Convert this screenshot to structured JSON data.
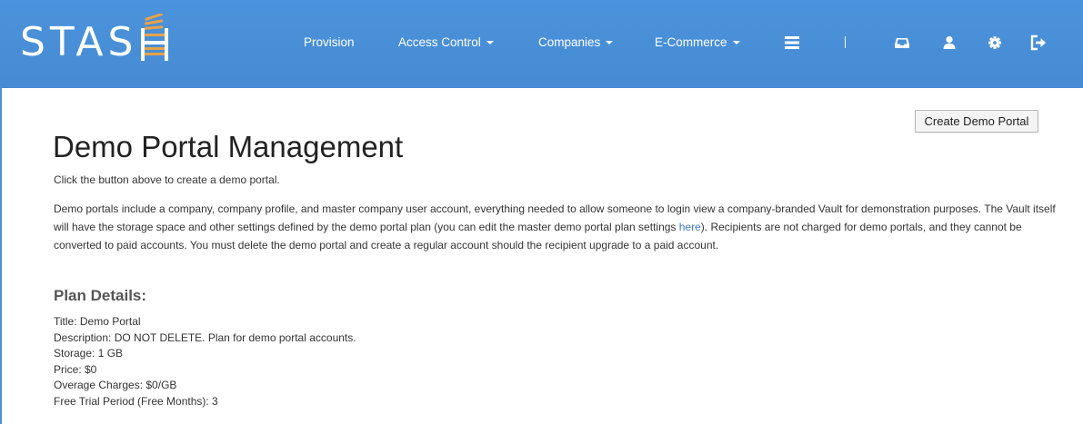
{
  "brand": {
    "text": "STAS"
  },
  "nav": {
    "items": [
      {
        "label": "Provision",
        "dropdown": false
      },
      {
        "label": "Access Control",
        "dropdown": true
      },
      {
        "label": "Companies",
        "dropdown": true
      },
      {
        "label": "E-Commerce",
        "dropdown": true
      }
    ],
    "icons": [
      "menu-icon",
      "inbox-icon",
      "user-icon",
      "gear-icon",
      "logout-icon"
    ]
  },
  "colors": {
    "navbar": "#4a90d9",
    "link": "#3b7bbf"
  },
  "actions": {
    "create_label": "Create Demo Portal"
  },
  "page": {
    "title": "Demo Portal Management",
    "intro": "Click the button above to create a demo portal.",
    "description_before_link": "Demo portals include a company, company profile, and master company user account, everything needed to allow someone to login view a company-branded Vault for demonstration purposes. The Vault itself will have the storage space and other settings defined by the demo portal plan (you can edit the master demo portal plan settings ",
    "description_link": "here",
    "description_after_link": "). Recipients are not charged for demo portals, and they cannot be converted to paid accounts. You must delete the demo portal and create a regular account should the recipient upgrade to a paid account."
  },
  "plan": {
    "heading": "Plan Details:",
    "rows": [
      "Title: Demo Portal",
      "Description: DO NOT DELETE. Plan for demo portal accounts.",
      "Storage: 1 GB",
      "Price: $0",
      "Overage Charges: $0/GB",
      "Free Trial Period (Free Months): 3"
    ]
  }
}
